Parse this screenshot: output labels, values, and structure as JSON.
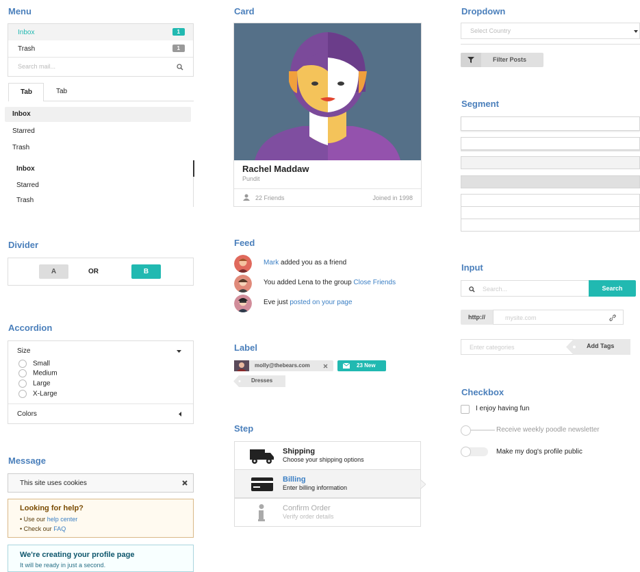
{
  "menu": {
    "title": "Menu",
    "items": [
      {
        "label": "Inbox",
        "count": "1"
      },
      {
        "label": "Trash",
        "count": "1"
      }
    ],
    "search_placeholder": "Search mail..."
  },
  "tabs": {
    "labels": [
      "Tab",
      "Tab"
    ],
    "list_a": [
      "Inbox",
      "Starred",
      "Trash"
    ],
    "list_b": [
      "Inbox",
      "Starred",
      "Trash"
    ]
  },
  "divider": {
    "title": "Divider",
    "left": "A",
    "middle": "OR",
    "right": "B"
  },
  "accordion": {
    "title": "Accordion",
    "size_label": "Size",
    "options": [
      "Small",
      "Medium",
      "Large",
      "X-Large"
    ],
    "colors_label": "Colors"
  },
  "message": {
    "title": "Message",
    "cookies": "This site uses cookies",
    "help": {
      "title": "Looking for help?",
      "line1_pre": "Use our",
      "line1_link": "help center",
      "line2_pre": "Check our",
      "line2_link": "FAQ"
    },
    "profile": {
      "title": "We're creating your profile page",
      "sub": "It will be ready in just a second."
    }
  },
  "card": {
    "title": "Card",
    "name": "Rachel Maddaw",
    "role": "Pundit",
    "friends": "22 Friends",
    "joined": "Joined in 1998"
  },
  "feed": {
    "title": "Feed",
    "items": [
      {
        "link_pre": "Mark",
        "text": " added you as a friend",
        "link_post": ""
      },
      {
        "link_pre": "",
        "text": "You added Lena to the group ",
        "link_post": "Close Friends"
      },
      {
        "link_pre": "",
        "text": "Eve just ",
        "link_post": "posted on your page"
      }
    ]
  },
  "label": {
    "title": "Label",
    "email": "molly@thebears.com",
    "new": "23 New",
    "tag": "Dresses"
  },
  "step": {
    "title": "Step",
    "items": [
      {
        "title": "Shipping",
        "desc": "Choose your shipping options"
      },
      {
        "title": "Billing",
        "desc": "Enter billing information"
      },
      {
        "title": "Confirm Order",
        "desc": "Verify order details"
      }
    ]
  },
  "dropdown": {
    "title": "Dropdown",
    "placeholder": "Select Country",
    "filter": "Filter Posts"
  },
  "segment": {
    "title": "Segment"
  },
  "input": {
    "title": "Input",
    "search_placeholder": "Search...",
    "search_button": "Search",
    "url_prefix": "http://",
    "url_placeholder": "mysite.com",
    "tags_placeholder": "Enter categories",
    "tags_button": "Add Tags"
  },
  "checkbox": {
    "title": "Checkbox",
    "items": [
      "I enjoy having fun",
      "Receive weekly poodle newsletter",
      "Make my dog's profile public"
    ]
  },
  "colors": {
    "teal": "#21b9b1",
    "blue": "#4a7fbb",
    "link": "#3b7fc4",
    "purple": "#7f4ea0"
  }
}
